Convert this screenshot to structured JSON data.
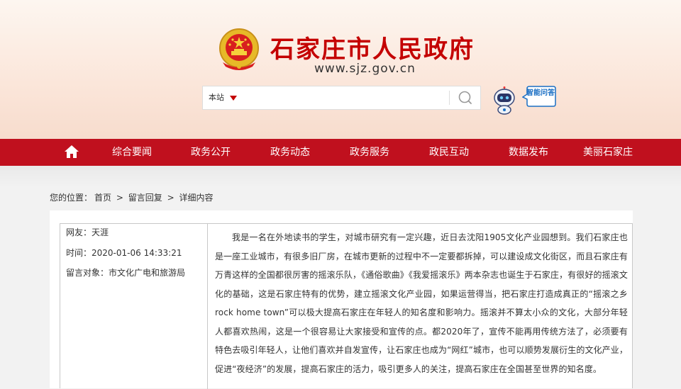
{
  "header": {
    "site_title": "石家庄市人民政府",
    "site_url": "www.sjz.gov.cn",
    "emblem_icon": "national-emblem-icon",
    "brand_color": "#c40000"
  },
  "search": {
    "scope_label": "本站",
    "value": "",
    "placeholder": "",
    "button_icon": "search-icon"
  },
  "assistant": {
    "robot_icon": "robot-icon",
    "label": "智能问答"
  },
  "nav": {
    "home_icon": "home-icon",
    "background_color": "#c0101e",
    "items": [
      "综合要闻",
      "政务公开",
      "政务动态",
      "政务服务",
      "政民互动",
      "数据发布",
      "美丽石家庄"
    ]
  },
  "breadcrumb": {
    "prefix": "您的位置：",
    "items": [
      "首页",
      "留言回复",
      "详细内容"
    ],
    "separator": ">"
  },
  "message": {
    "netizen_label": "网友：",
    "netizen_name": "天涯",
    "time_label": "时间：",
    "time_value": "2020-01-06 14:33:21",
    "target_label": "留言对象：",
    "target_value": "市文化广电和旅游局",
    "content": "我是一名在外地读书的学生，对城市研究有一定兴趣，近日去沈阳1905文化产业园想到。我们石家庄也是一座工业城市，有很多旧厂房，在城市更新的过程中不一定要都拆掉，可以建设成文化街区，而且石家庄有万青这样的全国都很厉害的摇滚乐队，《通俗歌曲》《我爱摇滚乐》两本杂志也诞生于石家庄，有很好的摇滚文化的基础，这是石家庄特有的优势，建立摇滚文化产业园，如果运营得当，把石家庄打造成真正的“摇滚之乡rock home town”可以极大提高石家庄在年轻人的知名度和影响力。摇滚并不算太小众的文化，大部分年轻人都喜欢热闹，这是一个很容易让大家接受和宣传的点。都2020年了，宣传不能再用传统方法了，必须要有特色去吸引年轻人，让他们喜欢并自发宣传，让石家庄也成为“网红”城市，也可以顺势发展衍生的文化产业，促进“夜经济”的发展，提高石家庄的活力，吸引更多人的关注，提高石家庄在全国甚至世界的知名度。"
  }
}
